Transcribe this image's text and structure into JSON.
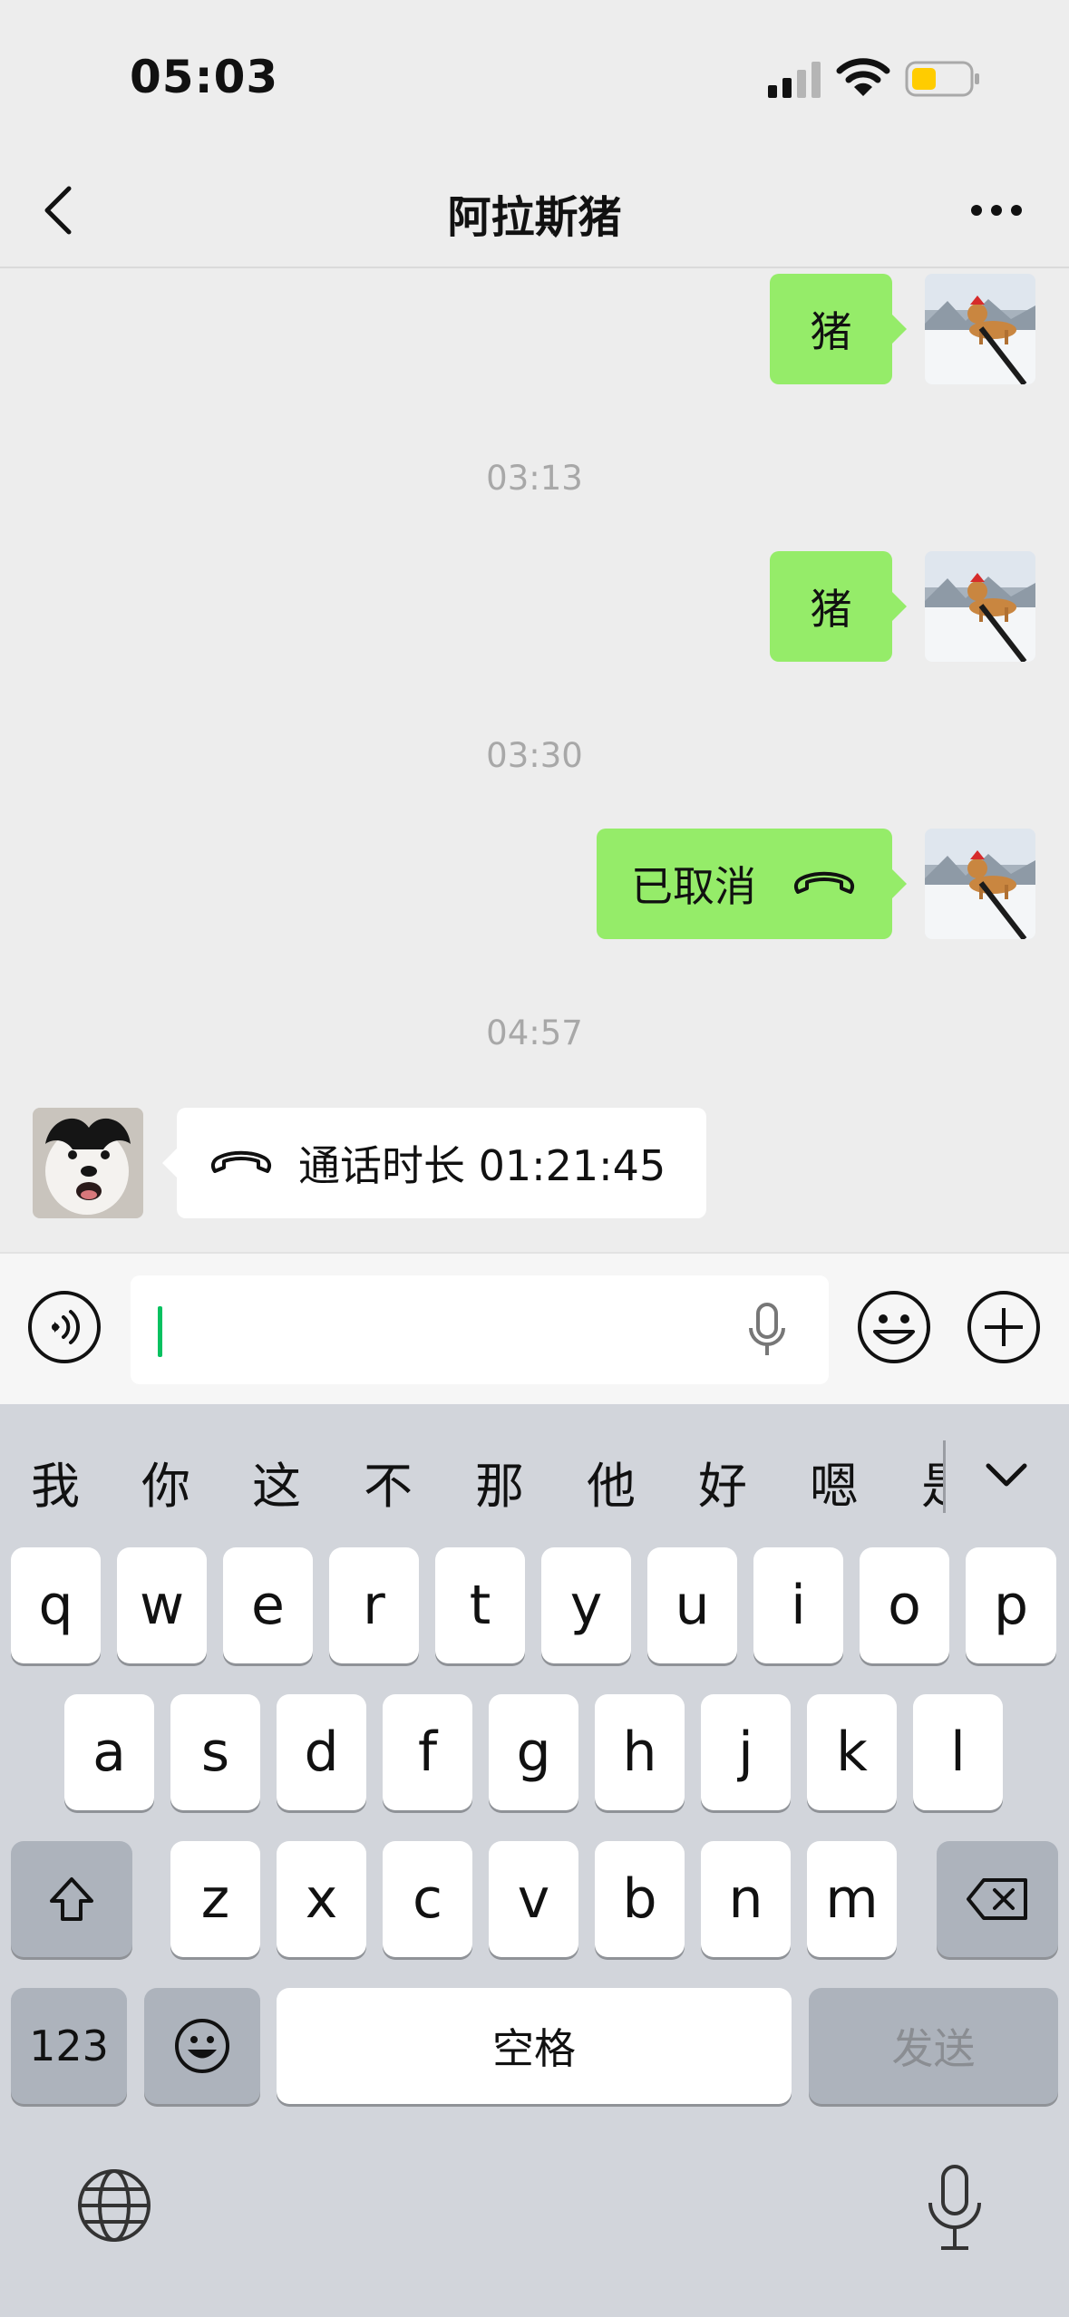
{
  "status_bar": {
    "time": "05:03",
    "battery_color": "#ffcc00"
  },
  "nav": {
    "title": "阿拉斯猪",
    "back_icon": "chevron-left-icon",
    "more_icon": "ellipsis-icon"
  },
  "messages": [
    {
      "side": "me",
      "text": "猪"
    },
    {
      "type": "timestamp",
      "text": "03:13"
    },
    {
      "side": "me",
      "text": "猪"
    },
    {
      "type": "timestamp",
      "text": "03:30"
    },
    {
      "side": "me",
      "text": "已取消",
      "icon": "phone-hangup-icon"
    },
    {
      "type": "timestamp",
      "text": "04:57"
    },
    {
      "side": "other",
      "text": "通话时长 01:21:45",
      "icon": "phone-hangup-icon"
    }
  ],
  "input": {
    "placeholder": ""
  },
  "keyboard": {
    "candidates": [
      "我",
      "你",
      "这",
      "不",
      "那",
      "他",
      "好",
      "嗯",
      "是"
    ],
    "row1": [
      "q",
      "w",
      "e",
      "r",
      "t",
      "y",
      "u",
      "i",
      "o",
      "p"
    ],
    "row2": [
      "a",
      "s",
      "d",
      "f",
      "g",
      "h",
      "j",
      "k",
      "l"
    ],
    "row3": [
      "z",
      "x",
      "c",
      "v",
      "b",
      "n",
      "m"
    ],
    "numbers_label": "123",
    "space_label": "空格",
    "send_label": "发送"
  },
  "colors": {
    "my_bubble": "#95ec69",
    "other_bubble": "#ffffff",
    "caret": "#07c160"
  }
}
